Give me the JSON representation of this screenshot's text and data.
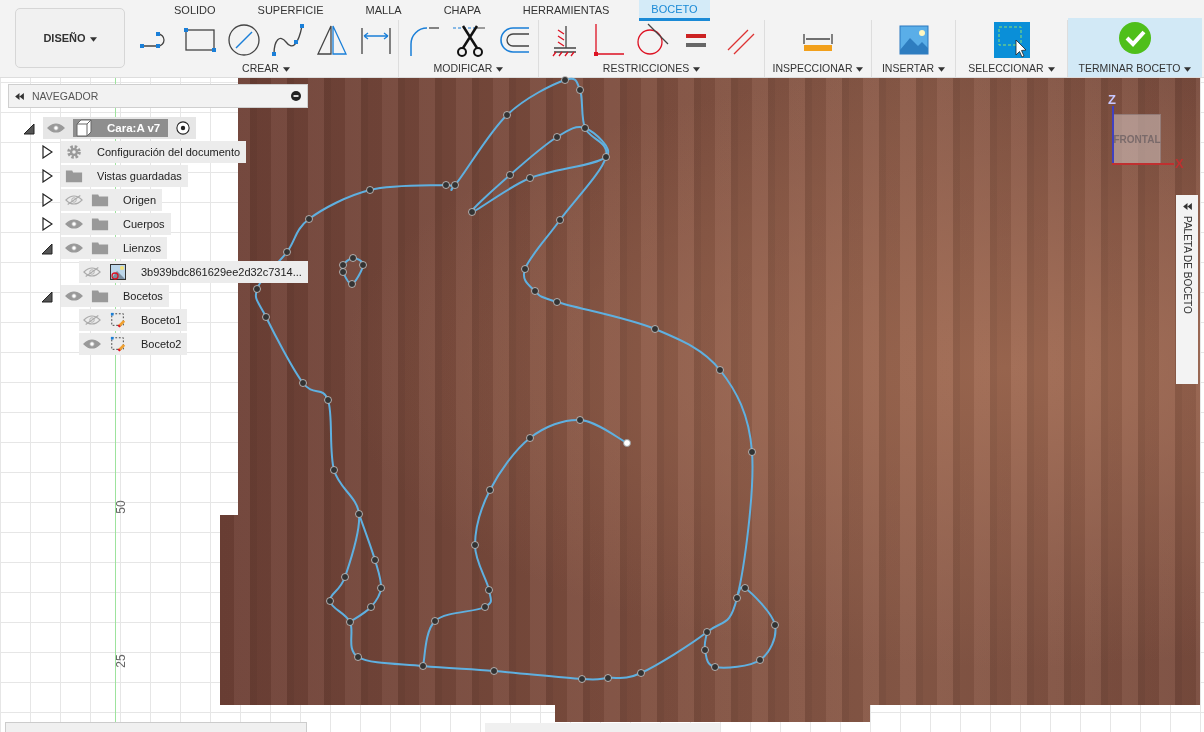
{
  "workspace": {
    "label": "DISEÑO"
  },
  "tabs": [
    {
      "label": "SOLIDO",
      "selected": false
    },
    {
      "label": "SUPERFICIE",
      "selected": false
    },
    {
      "label": "MALLA",
      "selected": false
    },
    {
      "label": "CHAPA",
      "selected": false
    },
    {
      "label": "HERRAMIENTAS",
      "selected": false
    },
    {
      "label": "BOCETO",
      "selected": true
    }
  ],
  "tool_groups": [
    {
      "label": "CREAR",
      "tools": [
        {
          "kind": "line"
        },
        {
          "kind": "rectangle"
        },
        {
          "kind": "circle"
        },
        {
          "kind": "spline"
        },
        {
          "kind": "mirror"
        },
        {
          "kind": "dimension"
        }
      ]
    },
    {
      "label": "MODIFICAR",
      "tools": [
        {
          "kind": "fillet"
        },
        {
          "kind": "trim"
        },
        {
          "kind": "offset"
        }
      ]
    },
    {
      "label": "RESTRICCIONES",
      "tools": [
        {
          "kind": "fix"
        },
        {
          "kind": "coincident"
        },
        {
          "kind": "tangent"
        },
        {
          "kind": "equal"
        },
        {
          "kind": "parallel"
        }
      ]
    },
    {
      "label": "INSPECCIONAR",
      "tools": [
        {
          "kind": "measure"
        }
      ]
    },
    {
      "label": "INSERTAR",
      "tools": [
        {
          "kind": "image"
        }
      ]
    },
    {
      "label": "SELECCIONAR",
      "tools": [
        {
          "kind": "select"
        }
      ]
    },
    {
      "label": "TERMINAR BOCETO",
      "tools": [
        {
          "kind": "finish"
        }
      ],
      "highlighted": true
    }
  ],
  "navigator": {
    "title": "NAVEGADOR",
    "tree": [
      {
        "label": "Cara:A v7",
        "kind": "component",
        "expanded": true,
        "visible": true,
        "children": [
          {
            "label": "Configuración del documento",
            "kind": "settings",
            "expanded": false
          },
          {
            "label": "Vistas guardadas",
            "kind": "folder",
            "expanded": false
          },
          {
            "label": "Origen",
            "kind": "folder",
            "expanded": false,
            "visible": false
          },
          {
            "label": "Cuerpos",
            "kind": "folder",
            "expanded": false,
            "visible": true
          },
          {
            "label": "Lienzos",
            "kind": "folder",
            "expanded": true,
            "visible": true,
            "children": [
              {
                "label": "3b939bdc861629ee2d32c7314...",
                "kind": "canvas",
                "visible": false
              }
            ]
          },
          {
            "label": "Bocetos",
            "kind": "folder",
            "expanded": true,
            "visible": true,
            "children": [
              {
                "label": "Boceto1",
                "kind": "sketch",
                "visible": false
              },
              {
                "label": "Boceto2",
                "kind": "sketch",
                "visible": true
              }
            ]
          }
        ]
      }
    ]
  },
  "view_cube": {
    "face": "FRONTAL",
    "axis_vertical": "Z",
    "axis_horizontal": "X"
  },
  "ruler_labels": [
    "50",
    "25"
  ],
  "sketch_palette": {
    "title": "PALETA DE BOCETO"
  }
}
